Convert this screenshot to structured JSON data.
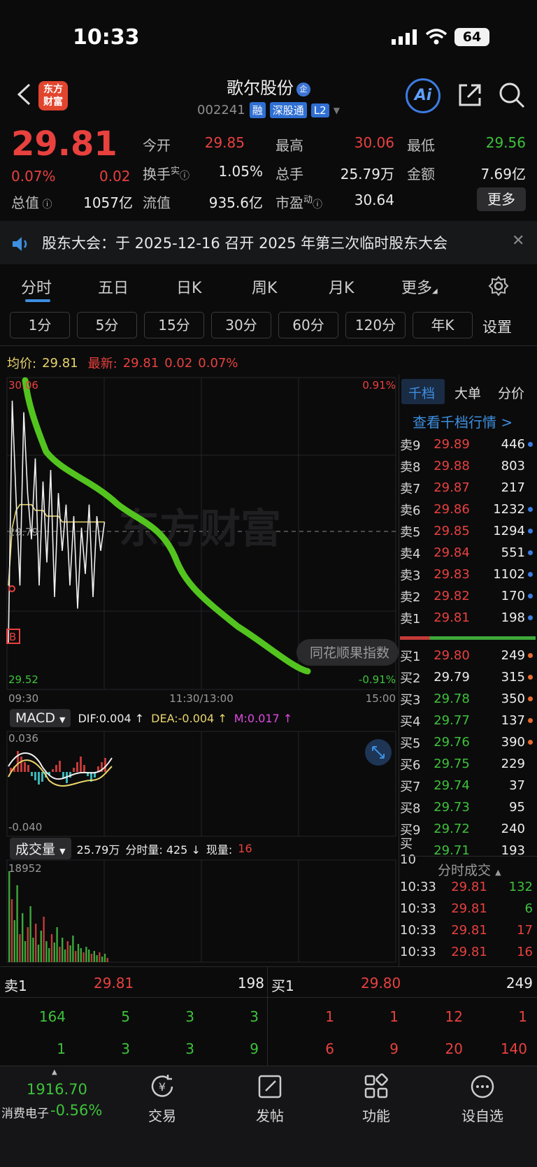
{
  "status": {
    "time": "10:33",
    "battery": "64"
  },
  "header": {
    "logo_line1": "东方",
    "logo_line2": "财富",
    "name": "歌尔股份",
    "qi_badge": "企",
    "code": "002241",
    "tags": [
      "融",
      "深股通",
      "L2"
    ],
    "ai_label": "Ai"
  },
  "quote": {
    "price": "29.81",
    "pct": "0.07%",
    "change": "0.02",
    "open_label": "今开",
    "open": "29.85",
    "high_label": "最高",
    "high": "30.06",
    "low_label": "最低",
    "low": "29.56",
    "turnover_label": "换手",
    "turnover_sup": "实",
    "turnover": "1.05%",
    "volume_label": "总手",
    "volume": "25.79万",
    "amount_label": "金额",
    "amount": "7.69亿",
    "mktcap_label": "总值",
    "mktcap": "1057亿",
    "float_label": "流值",
    "float": "935.6亿",
    "pe_label": "市盈",
    "pe_sup": "动",
    "pe": "30.64",
    "more": "更多"
  },
  "notice": {
    "text": "股东大会：于 2025-12-16 召开 2025 年第三次临时股东大会"
  },
  "tabs": [
    "分时",
    "五日",
    "日K",
    "周K",
    "月K",
    "更多"
  ],
  "periods": [
    "1分",
    "5分",
    "15分",
    "30分",
    "60分",
    "120分",
    "年K"
  ],
  "settings": "设置",
  "avg_row": {
    "avg_label": "均价:",
    "avg": "29.81",
    "latest_label": "最新:",
    "latest": "29.81",
    "chg": "0.02",
    "pct": "0.07%"
  },
  "chart_data": {
    "type": "line",
    "price_axis": {
      "top": "30.06",
      "mid": "29.79",
      "bottom": "29.52",
      "top_pct": "0.91%",
      "bottom_pct": "-0.91%"
    },
    "time_axis": [
      "09:30",
      "11:30/13:00",
      "15:00"
    ],
    "ylim": [
      29.52,
      30.06
    ],
    "prev_close": 29.79,
    "price_series": [
      29.6,
      30.02,
      29.85,
      29.7,
      30.0,
      29.86,
      29.78,
      29.92,
      29.7,
      29.88,
      29.74,
      29.9,
      29.68,
      29.86,
      29.76,
      29.84,
      29.7,
      29.82,
      29.66,
      29.8,
      29.72,
      29.84,
      29.68,
      29.82,
      29.76,
      29.81
    ],
    "avg_series": [
      29.7,
      29.8,
      29.83,
      29.84,
      29.84,
      29.84,
      29.84,
      29.83,
      29.83,
      29.83,
      29.82,
      29.82,
      29.82,
      29.82,
      29.81,
      29.81,
      29.81,
      29.81,
      29.81,
      29.81,
      29.81,
      29.81,
      29.81,
      29.81,
      29.81,
      29.81
    ],
    "overlay_label": "同花顺果指数",
    "watermark": "东方财富",
    "macd": {
      "label": "MACD",
      "dif": "DIF:0.004 ↑",
      "dea": "DEA:-0.004 ↑",
      "m": "M:0.017 ↑",
      "top": "0.036",
      "bottom": "-0.040"
    },
    "volume": {
      "label": "成交量",
      "total": "25.79万",
      "minute": "分时量: 425 ↓",
      "now_label": "现量:",
      "now": "16",
      "max": "18952"
    }
  },
  "orderbook": {
    "tabs": [
      "千档",
      "大单",
      "分价"
    ],
    "link": "查看千档行情 >",
    "asks": [
      {
        "label": "卖9",
        "price": "29.89",
        "vol": "446"
      },
      {
        "label": "卖8",
        "price": "29.88",
        "vol": "803"
      },
      {
        "label": "卖7",
        "price": "29.87",
        "vol": "217"
      },
      {
        "label": "卖6",
        "price": "29.86",
        "vol": "1232"
      },
      {
        "label": "卖5",
        "price": "29.85",
        "vol": "1294"
      },
      {
        "label": "卖4",
        "price": "29.84",
        "vol": "551"
      },
      {
        "label": "卖3",
        "price": "29.83",
        "vol": "1102"
      },
      {
        "label": "卖2",
        "price": "29.82",
        "vol": "170"
      },
      {
        "label": "卖1",
        "price": "29.81",
        "vol": "198"
      }
    ],
    "bids": [
      {
        "label": "买1",
        "price": "29.80",
        "vol": "249"
      },
      {
        "label": "买2",
        "price": "29.79",
        "vol": "315"
      },
      {
        "label": "买3",
        "price": "29.78",
        "vol": "350"
      },
      {
        "label": "买4",
        "price": "29.77",
        "vol": "137"
      },
      {
        "label": "买5",
        "price": "29.76",
        "vol": "390"
      },
      {
        "label": "买6",
        "price": "29.75",
        "vol": "229"
      },
      {
        "label": "买7",
        "price": "29.74",
        "vol": "37"
      },
      {
        "label": "买8",
        "price": "29.73",
        "vol": "95"
      },
      {
        "label": "买9",
        "price": "29.72",
        "vol": "240"
      },
      {
        "label": "买10",
        "price": "29.71",
        "vol": "193"
      }
    ],
    "ticks_label": "分时成交",
    "ticks": [
      {
        "time": "10:33",
        "price": "29.81",
        "vol": "132"
      },
      {
        "time": "10:33",
        "price": "29.81",
        "vol": "6"
      },
      {
        "time": "10:33",
        "price": "29.81",
        "vol": "17"
      },
      {
        "time": "10:33",
        "price": "29.81",
        "vol": "16"
      }
    ]
  },
  "bottom_book": {
    "sell_label": "卖1",
    "sell_price": "29.81",
    "sell_vol": "198",
    "buy_label": "买1",
    "buy_price": "29.80",
    "buy_vol": "249",
    "sell_row1": [
      "164",
      "5",
      "3",
      "3"
    ],
    "sell_row2": [
      "1",
      "3",
      "3",
      "9"
    ],
    "buy_row1": [
      "1",
      "1",
      "12",
      "1"
    ],
    "buy_row2": [
      "6",
      "9",
      "20",
      "140"
    ]
  },
  "nav": {
    "index_value": "1916.70",
    "index_name": "消费电子",
    "index_pct": "-0.56%",
    "items": [
      "交易",
      "发帖",
      "功能",
      "设自选"
    ]
  }
}
